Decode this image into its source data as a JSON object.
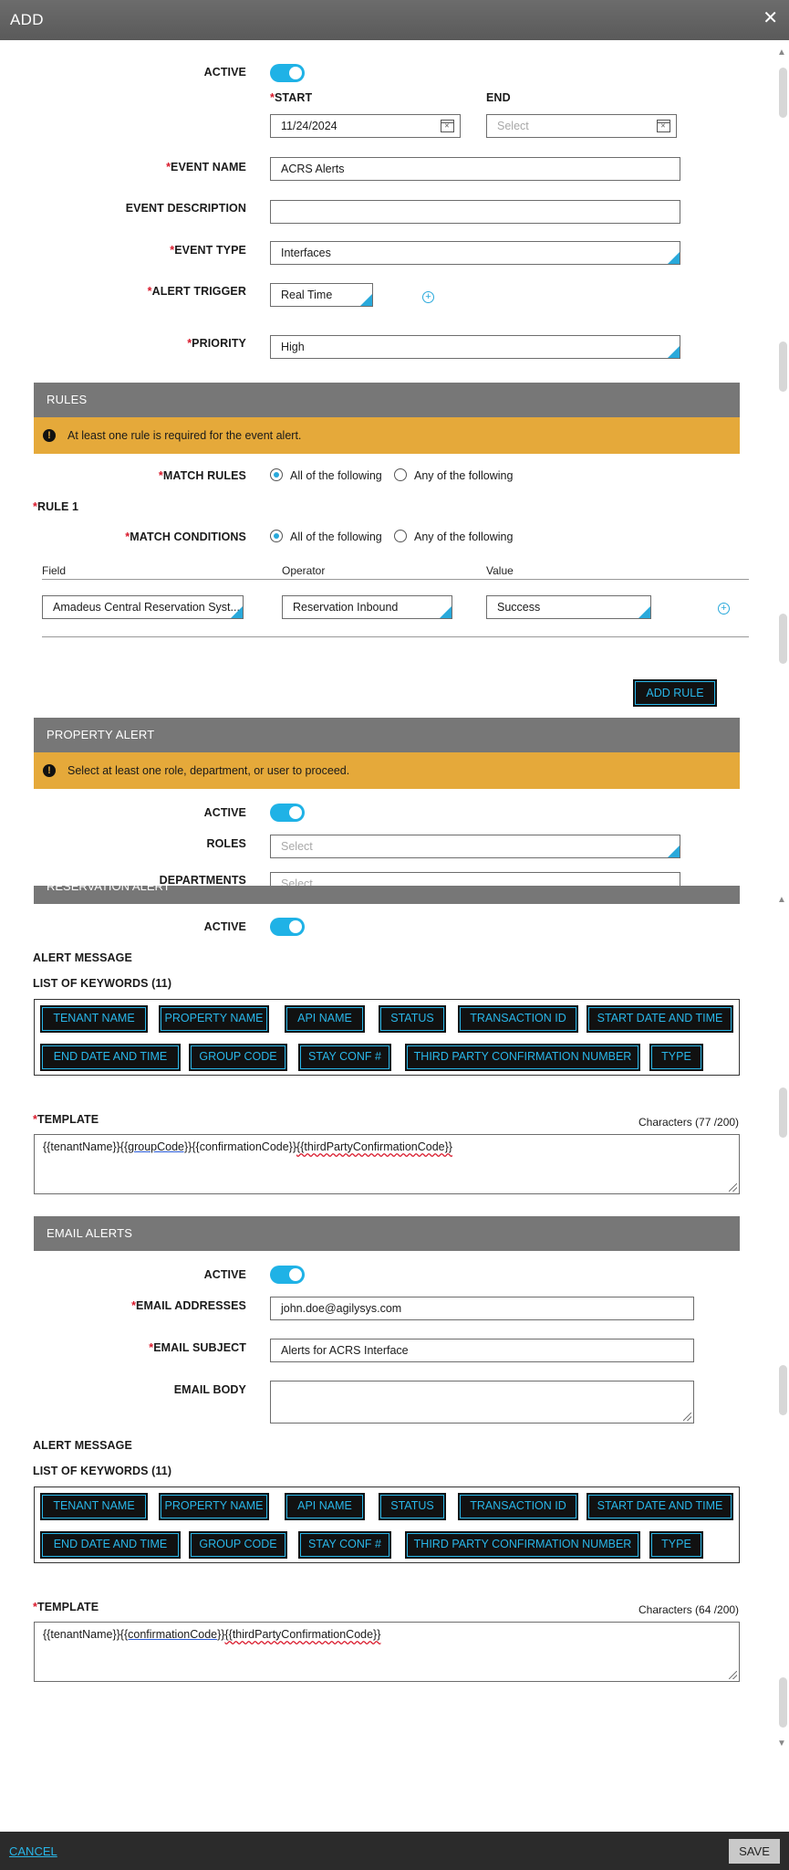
{
  "header": {
    "title": "ADD",
    "close_glyph": "✕"
  },
  "footer": {
    "cancel_label": "CANCEL",
    "save_label": "SAVE"
  },
  "general": {
    "active_label": "ACTIVE",
    "start_label": "START",
    "start_value": "11/24/2024",
    "end_label": "END",
    "end_placeholder": "Select",
    "event_name_label": "EVENT NAME",
    "event_name_value": "ACRS Alerts",
    "event_description_label": "EVENT DESCRIPTION",
    "event_description_value": "",
    "event_type_label": "EVENT TYPE",
    "event_type_value": "Interfaces",
    "alert_trigger_label": "ALERT TRIGGER",
    "alert_trigger_value": "Real Time",
    "priority_label": "PRIORITY",
    "priority_value": "High"
  },
  "rules": {
    "banner": "RULES",
    "warning": "At least one rule is required for the event alert.",
    "match_rules_label": "MATCH RULES",
    "option_all": "All of the following",
    "option_any": "Any of the following",
    "rule_title": "RULE 1",
    "match_conditions_label": "MATCH CONDITIONS",
    "columns": [
      "Field",
      "Operator",
      "Value"
    ],
    "row": {
      "field": "Amadeus Central Reservation Syst...",
      "operator": "Reservation Inbound",
      "value": "Success"
    },
    "add_rule_label": "ADD RULE"
  },
  "property_alert": {
    "banner": "PROPERTY ALERT",
    "warning": "Select at least one role, department, or user to proceed.",
    "active_label": "ACTIVE",
    "roles_label": "ROLES",
    "roles_placeholder": "Select",
    "departments_label": "DEPARTMENTS",
    "departments_placeholder": "Select"
  },
  "reservation_alert": {
    "banner": "RESERVATION ALERT",
    "active_label": "ACTIVE",
    "alert_message_label": "ALERT MESSAGE",
    "keywords_label": "LIST OF KEYWORDS (11)",
    "keywords": [
      "TENANT NAME",
      "PROPERTY NAME",
      "API NAME",
      "STATUS",
      "TRANSACTION ID",
      "START DATE AND TIME",
      "END DATE AND TIME",
      "GROUP CODE",
      "STAY CONF #",
      "THIRD PARTY CONFIRMATION NUMBER",
      "TYPE"
    ],
    "template_label": "TEMPLATE",
    "characters": "Characters (77 /200)",
    "template_parts": [
      "{{tenantName}}",
      "{{groupCode}}",
      "{{confirmationCode}}",
      "{{thirdPartyConfirmationCode}}"
    ]
  },
  "email_alerts": {
    "banner": "EMAIL ALERTS",
    "active_label": "ACTIVE",
    "addresses_label": "EMAIL ADDRESSES",
    "addresses_value": "john.doe@agilysys.com",
    "subject_label": "EMAIL SUBJECT",
    "subject_value": "Alerts for ACRS Interface",
    "body_label": "EMAIL BODY",
    "body_value": "",
    "alert_message_label": "ALERT MESSAGE",
    "keywords_label": "LIST OF KEYWORDS (11)",
    "keywords": [
      "TENANT NAME",
      "PROPERTY NAME",
      "API NAME",
      "STATUS",
      "TRANSACTION ID",
      "START DATE AND TIME",
      "END DATE AND TIME",
      "GROUP CODE",
      "STAY CONF #",
      "THIRD PARTY CONFIRMATION NUMBER",
      "TYPE"
    ],
    "template_label": "TEMPLATE",
    "characters": "Characters (64 /200)",
    "template_parts": [
      "{{tenantName}}",
      "{{confirmationCode}}",
      "{{thirdPartyConfirmationCode}}"
    ]
  },
  "required_mark": "*",
  "plus_glyph": "+",
  "warning_glyph": "!",
  "scroll_up_glyph": "▲",
  "scroll_down_glyph": "▼",
  "colors": {
    "accent": "#29a9db",
    "banner": "#777777",
    "warning": "#e5a93a",
    "required": "#d9182a"
  }
}
